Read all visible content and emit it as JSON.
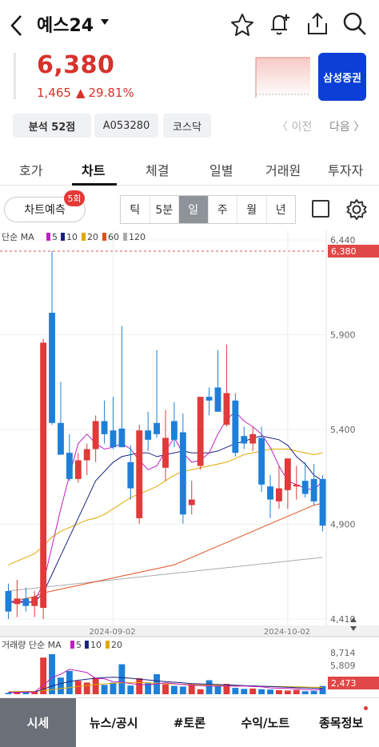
{
  "header": {
    "title": "예스24",
    "back_icon": "chevron-left-icon",
    "star_icon": "star-icon",
    "alert_icon": "bell-plus-icon",
    "share_icon": "share-icon",
    "search_icon": "search-icon"
  },
  "quote": {
    "price": "6,380",
    "change": "1,465",
    "change_pct": "29.81%",
    "up_color": "#d6322b",
    "broker_label": "삼성증권",
    "broker_color": "#0b3fd6"
  },
  "tags": {
    "analysis": "분석 52점",
    "code": "A053280",
    "market": "코스닥",
    "prev": "〈 이전",
    "next": "다음 〉"
  },
  "tabs": [
    "호가",
    "차트",
    "체결",
    "일별",
    "거래원",
    "투자자"
  ],
  "controls": {
    "predict_label": "차트예측",
    "predict_badge": "5회",
    "periods": [
      "틱",
      "5분",
      "일",
      "주",
      "월",
      "년"
    ],
    "selected_period": "일"
  },
  "chart_data": {
    "type": "candlestick",
    "price_axis_ticks": [
      "6,440",
      "5,900",
      "5,400",
      "4,900",
      "4,410"
    ],
    "ylim": [
      4410,
      6440
    ],
    "current_price_label": "6,380",
    "x_ticks": [
      "2024-09-02",
      "2024-10-02"
    ],
    "ma_legend": {
      "prefix": "단순 MA",
      "periods": [
        "5",
        "10",
        "20",
        "60",
        "120"
      ],
      "colors": [
        "#c020c0",
        "#1a237e",
        "#e0a800",
        "#e05020",
        "#aaaaaa"
      ]
    },
    "candles": [
      {
        "o": 4560,
        "h": 4600,
        "l": 4410,
        "c": 4450
      },
      {
        "o": 4490,
        "h": 4620,
        "l": 4420,
        "c": 4520
      },
      {
        "o": 4520,
        "h": 4580,
        "l": 4450,
        "c": 4480
      },
      {
        "o": 4480,
        "h": 4560,
        "l": 4420,
        "c": 4530
      },
      {
        "o": 4470,
        "h": 5910,
        "l": 4410,
        "c": 5890
      },
      {
        "o": 6050,
        "h": 6380,
        "l": 5450,
        "c": 5460
      },
      {
        "o": 5460,
        "h": 5680,
        "l": 5300,
        "c": 5290
      },
      {
        "o": 5300,
        "h": 5400,
        "l": 5150,
        "c": 5160
      },
      {
        "o": 5160,
        "h": 5300,
        "l": 5140,
        "c": 5260
      },
      {
        "o": 5260,
        "h": 5350,
        "l": 5180,
        "c": 5320
      },
      {
        "o": 5320,
        "h": 5500,
        "l": 5250,
        "c": 5470
      },
      {
        "o": 5470,
        "h": 5580,
        "l": 5350,
        "c": 5400
      },
      {
        "o": 5420,
        "h": 5600,
        "l": 5320,
        "c": 5330
      },
      {
        "o": 5430,
        "h": 5980,
        "l": 5330,
        "c": 5330
      },
      {
        "o": 5250,
        "h": 5340,
        "l": 5050,
        "c": 5110
      },
      {
        "o": 4950,
        "h": 5450,
        "l": 4920,
        "c": 5420
      },
      {
        "o": 5420,
        "h": 5520,
        "l": 5310,
        "c": 5370
      },
      {
        "o": 5460,
        "h": 5850,
        "l": 5380,
        "c": 5400
      },
      {
        "o": 5220,
        "h": 5530,
        "l": 5150,
        "c": 5380
      },
      {
        "o": 5470,
        "h": 5570,
        "l": 5330,
        "c": 5370
      },
      {
        "o": 5410,
        "h": 5510,
        "l": 4920,
        "c": 4970
      },
      {
        "o": 5020,
        "h": 5150,
        "l": 4970,
        "c": 5050
      },
      {
        "o": 5230,
        "h": 5540,
        "l": 5210,
        "c": 5600
      },
      {
        "o": 5600,
        "h": 5650,
        "l": 5500,
        "c": 5580
      },
      {
        "o": 5650,
        "h": 5850,
        "l": 5520,
        "c": 5520
      },
      {
        "o": 5450,
        "h": 5880,
        "l": 5440,
        "c": 5620
      },
      {
        "o": 5580,
        "h": 5620,
        "l": 5280,
        "c": 5300
      },
      {
        "o": 5390,
        "h": 5440,
        "l": 5320,
        "c": 5350
      },
      {
        "o": 5350,
        "h": 5440,
        "l": 5310,
        "c": 5400
      },
      {
        "o": 5380,
        "h": 5440,
        "l": 5090,
        "c": 5130
      },
      {
        "o": 5120,
        "h": 5180,
        "l": 4950,
        "c": 5050
      },
      {
        "o": 5040,
        "h": 5230,
        "l": 5000,
        "c": 5110
      },
      {
        "o": 5100,
        "h": 5150,
        "l": 5000,
        "c": 5270
      },
      {
        "o": 5120,
        "h": 5230,
        "l": 5050,
        "c": 5130
      },
      {
        "o": 5150,
        "h": 5250,
        "l": 5060,
        "c": 5080
      },
      {
        "o": 5160,
        "h": 5240,
        "l": 5020,
        "c": 5040
      },
      {
        "o": 5160,
        "h": 5180,
        "l": 4880,
        "c": 4910
      }
    ],
    "ma5": [
      4500,
      4510,
      4500,
      4505,
      4600,
      4800,
      5000,
      5180,
      5350,
      5400,
      5350,
      5320,
      5330,
      5350,
      5320,
      5260,
      5210,
      5230,
      5310,
      5380,
      5300,
      5250,
      5260,
      5300,
      5400,
      5480,
      5520,
      5470,
      5440,
      5400,
      5330,
      5230,
      5150,
      5130,
      5110,
      5100,
      5150
    ],
    "ma10": [
      4500,
      4500,
      4500,
      4500,
      4550,
      4650,
      4750,
      4850,
      4950,
      5050,
      5150,
      5200,
      5250,
      5280,
      5290,
      5300,
      5300,
      5280,
      5290,
      5300,
      5310,
      5300,
      5300,
      5300,
      5310,
      5330,
      5350,
      5360,
      5380,
      5390,
      5380,
      5370,
      5340,
      5280,
      5240,
      5180,
      5150
    ],
    "ma20": [
      4700,
      4720,
      4740,
      4760,
      4800,
      4850,
      4880,
      4900,
      4920,
      4940,
      4950,
      4970,
      5000,
      5030,
      5060,
      5080,
      5100,
      5120,
      5150,
      5180,
      5200,
      5210,
      5220,
      5230,
      5240,
      5250,
      5270,
      5290,
      5300,
      5310,
      5320,
      5320,
      5320,
      5310,
      5300,
      5290,
      5300
    ],
    "ma60": [
      4500,
      4510,
      4520,
      4530,
      4550,
      4560,
      4570,
      4580,
      4590,
      4600,
      4610,
      4620,
      4630,
      4640,
      4650,
      4660,
      4670,
      4680,
      4690,
      4700,
      4720,
      4740,
      4760,
      4780,
      4800,
      4820,
      4840,
      4860,
      4880,
      4900,
      4920,
      4940,
      4960,
      4980,
      5000,
      5020,
      5030
    ],
    "ma120": [
      4560,
      4565,
      4570,
      4575,
      4580,
      4585,
      4590,
      4595,
      4600,
      4605,
      4610,
      4615,
      4620,
      4625,
      4630,
      4635,
      4640,
      4645,
      4650,
      4655,
      4660,
      4665,
      4670,
      4675,
      4680,
      4685,
      4690,
      4695,
      4700,
      4705,
      4710,
      4715,
      4720,
      4725,
      4730,
      4735,
      4740
    ],
    "volume_legend": {
      "prefix": "거래량 단순 MA",
      "periods": [
        "5",
        "10",
        "20"
      ],
      "colors": [
        "#c020c0",
        "#1a237e",
        "#e0a800"
      ]
    },
    "volume_ticks": [
      "8,714",
      "5,809",
      "2,473"
    ],
    "volume_ylim": [
      0,
      12000
    ],
    "volumes": [
      400,
      700,
      600,
      800,
      11000,
      13000,
      5000,
      7000,
      4000,
      3500,
      5000,
      2800,
      3500,
      9000,
      2600,
      4800,
      3400,
      6000,
      3000,
      2500,
      2300,
      3200,
      1500,
      4200,
      2400,
      3100,
      1900,
      1600,
      1700,
      1500,
      1400,
      1200,
      1100,
      1300,
      900,
      1000,
      2473
    ],
    "vol_ma5": [
      500,
      550,
      600,
      650,
      2700,
      5000,
      6000,
      7500,
      7000,
      6500,
      4800,
      4600,
      3800,
      3700,
      3200,
      2900,
      2800,
      3100,
      3400,
      3200,
      2900,
      2700,
      2600,
      2500,
      2400,
      2500,
      2400,
      2500,
      2300,
      2200,
      1900,
      1800,
      1700,
      1600,
      1400,
      1300,
      1400
    ],
    "vol_ma10": [
      600,
      600,
      650,
      700,
      1500,
      2500,
      3200,
      3800,
      4200,
      4500,
      4800,
      5000,
      5100,
      5000,
      4800,
      4500,
      4300,
      4000,
      3800,
      3600,
      3400,
      3200,
      3100,
      3000,
      2900,
      2800,
      2700,
      2600,
      2500,
      2400,
      2300,
      2200,
      2100,
      2000,
      1900,
      1800,
      1700
    ],
    "vol_ma20": [
      800,
      820,
      840,
      860,
      1100,
      1400,
      1700,
      2000,
      2300,
      2600,
      2900,
      3100,
      3300,
      3400,
      3500,
      3500,
      3400,
      3300,
      3200,
      3100,
      3000,
      2900,
      2800,
      2700,
      2650,
      2600,
      2550,
      2500,
      2450,
      2400,
      2350,
      2300,
      2250,
      2200,
      2150,
      2100,
      2050
    ],
    "up_color": "#e03a3a",
    "down_color": "#1e7fd8"
  },
  "bottom_nav": [
    "시세",
    "뉴스/공시",
    "#토론",
    "수익/노트",
    "종목정보"
  ]
}
